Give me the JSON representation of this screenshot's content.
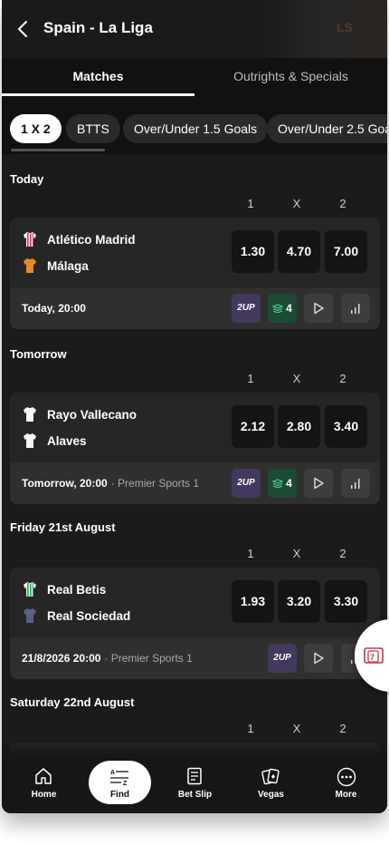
{
  "header": {
    "title": "Spain - La Liga",
    "art_text": "LS"
  },
  "tabs": [
    {
      "label": "Matches",
      "active": true
    },
    {
      "label": "Outrights & Specials",
      "active": false
    }
  ],
  "filters": [
    {
      "label": "1 X 2",
      "active": true
    },
    {
      "label": "BTTS",
      "active": false
    },
    {
      "label": "Over/Under 1.5 Goals",
      "active": false
    },
    {
      "label": "Over/Under 2.5 Goals",
      "active": false
    }
  ],
  "columns": [
    "1",
    "X",
    "2"
  ],
  "sections": [
    {
      "title": "Today",
      "match": {
        "home": "Atlético Madrid",
        "away": "Málaga",
        "home_kit": "striped-red-shirt-icon",
        "away_kit": "orange-shirt-icon",
        "odds": [
          "1.30",
          "4.70",
          "7.00"
        ],
        "time": "Today, 20:00",
        "channel": "",
        "badges": {
          "twoup": "2UP",
          "bet_builder": "4"
        }
      }
    },
    {
      "title": "Tomorrow",
      "match": {
        "home": "Rayo Vallecano",
        "away": "Alaves",
        "home_kit": "white-shirt-icon",
        "away_kit": "white-shirt-icon",
        "odds": [
          "2.12",
          "2.80",
          "3.40"
        ],
        "time": "Tomorrow, 20:00",
        "channel": "· Premier Sports 1",
        "badges": {
          "twoup": "2UP",
          "bet_builder": "4"
        }
      }
    },
    {
      "title": "Friday 21st August",
      "match": {
        "home": "Real Betis",
        "away": "Real Sociedad",
        "home_kit": "striped-green-shirt-icon",
        "away_kit": "navy-shirt-icon",
        "odds": [
          "1.93",
          "3.20",
          "3.30"
        ],
        "time": "21/8/2026 20:00",
        "channel": "· Premier Sports 1",
        "badges": {
          "twoup": "2UP"
        }
      }
    },
    {
      "title": "Saturday 22nd August"
    }
  ],
  "nav": [
    {
      "label": "Home",
      "icon": "home-icon"
    },
    {
      "label": "Find",
      "icon": "sort-az-icon",
      "active": true
    },
    {
      "label": "Bet Slip",
      "icon": "betslip-icon"
    },
    {
      "label": "Vegas",
      "icon": "cards-icon"
    },
    {
      "label": "More",
      "icon": "more-dots-icon"
    }
  ],
  "colors": {
    "background": "#1b1b1b",
    "card": "#262626",
    "odds_box": "#141414",
    "twoup_badge": "#43385d",
    "bet_builder_badge": "#1d4a35"
  }
}
